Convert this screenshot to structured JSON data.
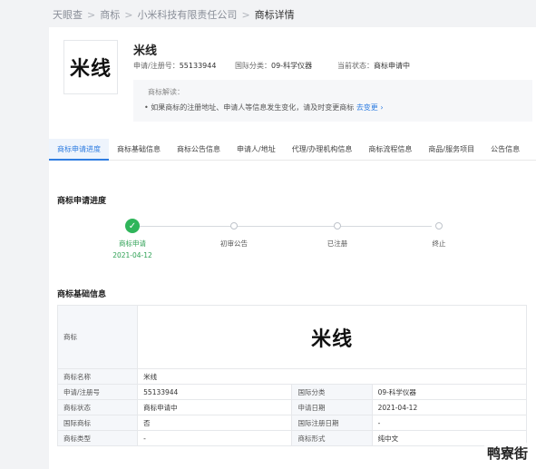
{
  "breadcrumb": [
    "天眼查",
    "商标",
    "小米科技有限责任公司",
    "商标详情"
  ],
  "header": {
    "logo_text": "米线",
    "name": "米线",
    "reg_no_label": "申请/注册号：",
    "reg_no": "55133944",
    "class_label": "国际分类：",
    "class_value": "09-科学仪器",
    "status_label": "当前状态：",
    "status_value": "商标申请中"
  },
  "notice": {
    "title": "商标解读：",
    "text": "• 如果商标的注册地址、申请人等信息发生变化，请及时变更商标",
    "link": "去变更 ›"
  },
  "tabs": [
    "商标申请进度",
    "商标基础信息",
    "商标公告信息",
    "申请人/地址",
    "代理/办理机构信息",
    "商标流程信息",
    "商品/服务项目",
    "公告信息"
  ],
  "progress": {
    "title": "商标申请进度",
    "steps": [
      {
        "label": "商标申请",
        "date": "2021-04-12",
        "done": true
      },
      {
        "label": "初审公告",
        "date": "",
        "done": false
      },
      {
        "label": "已注册",
        "date": "",
        "done": false
      },
      {
        "label": "终止",
        "date": "",
        "done": false
      }
    ]
  },
  "basic": {
    "title": "商标基础信息",
    "image_label": "商标",
    "image_text": "米线",
    "rows": [
      {
        "k1": "商标名称",
        "v1": "米线",
        "k2": "",
        "v2": ""
      },
      {
        "k1": "申请/注册号",
        "v1": "55133944",
        "k2": "国际分类",
        "v2": "09-科学仪器"
      },
      {
        "k1": "商标状态",
        "v1": "商标申请中",
        "k2": "申请日期",
        "v2": "2021-04-12"
      },
      {
        "k1": "国际商标",
        "v1": "否",
        "k2": "国际注册日期",
        "v2": "-"
      },
      {
        "k1": "商标类型",
        "v1": "-",
        "k2": "商标形式",
        "v2": "纯中文"
      }
    ]
  },
  "watermark": "鸭寮街"
}
